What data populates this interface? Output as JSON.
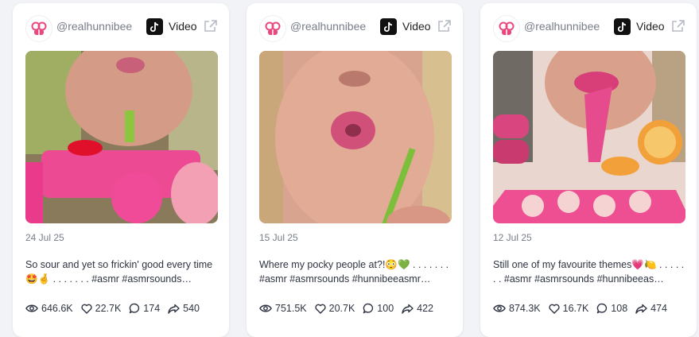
{
  "cards": [
    {
      "handle": "@realhunnibee",
      "platform": "Video",
      "date": "24 Jul 25",
      "caption": "So sour and yet so frickin' good every time 🤩🤞 . . . . . . . #asmr #asmrsounds…",
      "stats": {
        "views": "646.6K",
        "likes": "22.7K",
        "comments": "174",
        "shares": "540"
      }
    },
    {
      "handle": "@realhunnibee",
      "platform": "Video",
      "date": "15 Jul 25",
      "caption": "Where my pocky people at?!😳💚 . . . . . . . #asmr #asmrsounds #hunnibeeasmr…",
      "stats": {
        "views": "751.5K",
        "likes": "20.7K",
        "comments": "100",
        "shares": "422"
      }
    },
    {
      "handle": "@realhunnibee",
      "platform": "Video",
      "date": "12 Jul 25",
      "caption": "Still one of my favourite themes💗🍋 . . . . . . . #asmr #asmrsounds #hunnibeeas…",
      "stats": {
        "views": "874.3K",
        "likes": "16.7K",
        "comments": "108",
        "shares": "474"
      }
    }
  ],
  "colors": {
    "brand": "#e8487e",
    "muted": "#777d89",
    "text": "#2d3340"
  },
  "icons": [
    "hunnibee-logo-icon",
    "tiktok-icon",
    "external-link-icon",
    "eye-icon",
    "heart-icon",
    "comment-icon",
    "share-icon"
  ]
}
